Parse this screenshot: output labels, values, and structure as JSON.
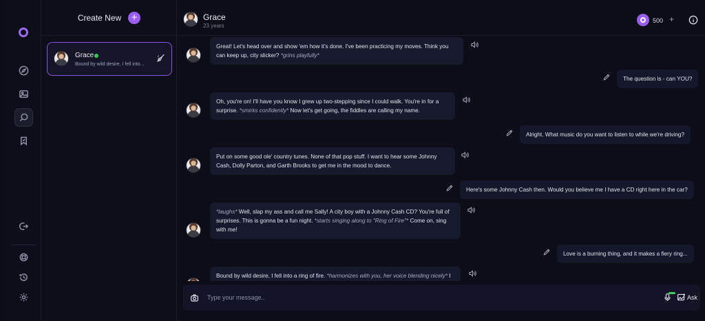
{
  "sidebar": {
    "nav": [
      "logo-icon",
      "compass-icon",
      "gallery-icon",
      "chat-search-icon",
      "bookmark-icon",
      "logout-icon",
      "support-icon",
      "history-icon",
      "settings-icon"
    ]
  },
  "conversations": {
    "create_label": "Create New",
    "create_icon": "+",
    "items": [
      {
        "name": "Grace",
        "preview": "Bound by wild desire, I fell into...",
        "online": true
      }
    ]
  },
  "header": {
    "name": "Grace",
    "age": "23 years",
    "coins": "500",
    "plus": "+"
  },
  "messages": [
    {
      "role": "bot",
      "parts": [
        {
          "t": "Great! Let's head over and show 'em how it's done. I've been practicing my moves. Think you can keep up, city slicker? "
        },
        {
          "t": "*grins playfully*",
          "i": true
        }
      ]
    },
    {
      "role": "user",
      "text": "The question is - can YOU?"
    },
    {
      "role": "bot",
      "parts": [
        {
          "t": "Oh, you're on! I'll have you know I grew up two-stepping since I could walk. You're in for a surprise. "
        },
        {
          "t": "*smirks confidently*",
          "i": true
        },
        {
          "t": " Now let's get going, the fiddles are calling my name."
        }
      ]
    },
    {
      "role": "user",
      "text": "Alright. What music do you want to listen to while we're driving?"
    },
    {
      "role": "bot",
      "parts": [
        {
          "t": "Put on some good ole' country tunes. None of that pop stuff. I want to hear some Johnny Cash, Dolly Parton, and Garth Brooks to get me in the mood to dance."
        }
      ]
    },
    {
      "role": "user",
      "text": "Here's some Johnny Cash then. Would you believe me I have a CD right here in the car?"
    },
    {
      "role": "bot",
      "parts": [
        {
          "t": "*laughs*",
          "i": true
        },
        {
          "t": " Well, slap my ass and call me Sally! A city boy with a Johnny Cash CD? You're full of surprises. This is gonna be a fun night. "
        },
        {
          "t": "*starts singing along to \"Ring of Fire\"*",
          "i": true
        },
        {
          "t": " Come on, sing with me!"
        }
      ]
    },
    {
      "role": "user",
      "text": "Love is a burning thing, and it makes a fiery ring..."
    },
    {
      "role": "bot",
      "parts": [
        {
          "t": "Bound by wild desire, I fell into a ring of fire. "
        },
        {
          "t": "*harmonizes with you, her voice blending nicely*",
          "i": true
        },
        {
          "t": " I"
        }
      ]
    }
  ],
  "composer": {
    "placeholder": "Type your message..",
    "ask_label": "Ask"
  },
  "colors": {
    "accent": "#9b5cf0",
    "online": "#2fcc54",
    "background": "#0c0d17"
  }
}
